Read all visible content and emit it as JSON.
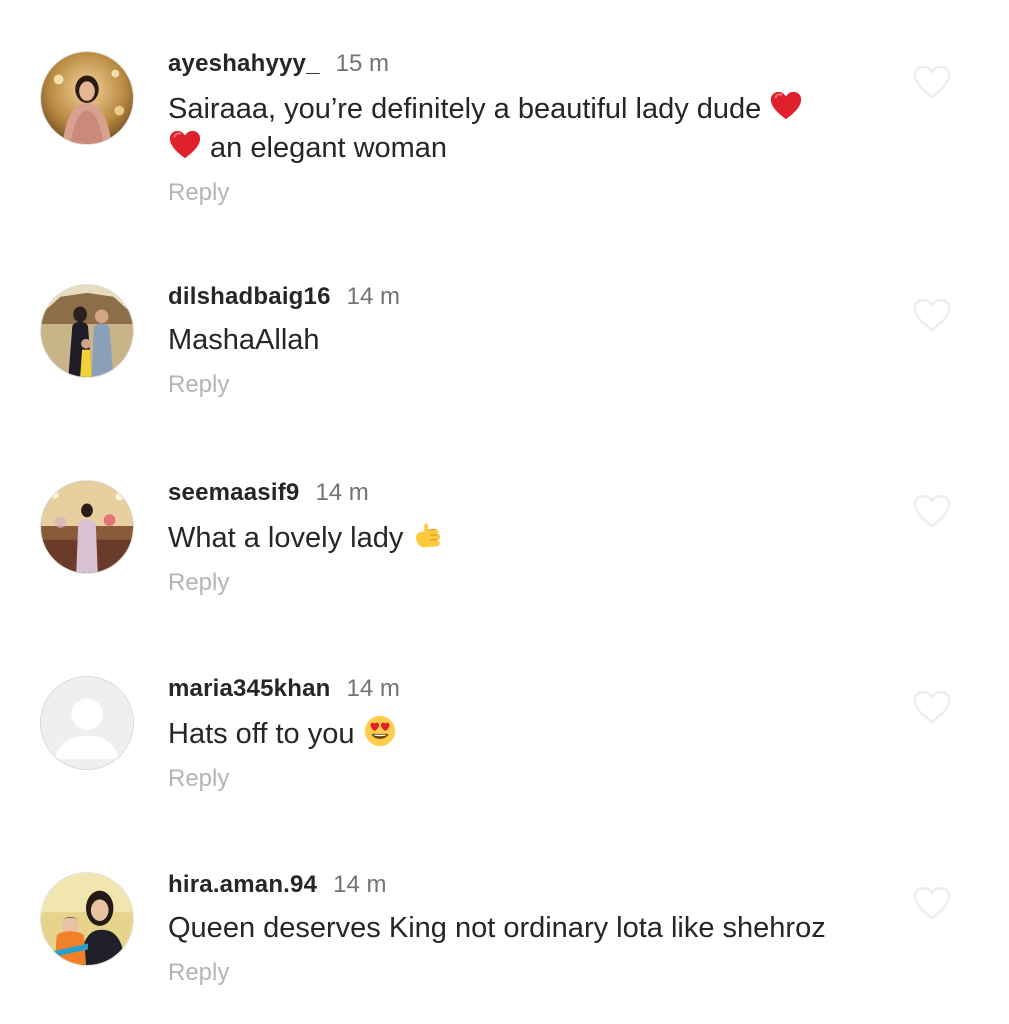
{
  "comments": [
    {
      "username": "ayeshahyyy_",
      "time": "15 m",
      "text_part1": "Sairaaa, you’re definitely a beautiful lady dude ",
      "text_part2": " an elegant woman",
      "emoji_1": "red-heart",
      "emoji_2": "red-heart",
      "reply_label": "Reply"
    },
    {
      "username": "dilshadbaig16",
      "time": "14 m",
      "text": "MashaAllah",
      "reply_label": "Reply"
    },
    {
      "username": "seemaasif9",
      "time": "14 m",
      "text": "What a lovely lady ",
      "emoji": "call-me-hand",
      "reply_label": "Reply"
    },
    {
      "username": "maria345khan",
      "time": "14 m",
      "text": "Hats off to you ",
      "emoji": "heart-eyes-face",
      "reply_label": "Reply"
    },
    {
      "username": "hira.aman.94",
      "time": "14 m",
      "text": "Queen deserves King not ordinary lota like shehroz",
      "reply_label": "Reply"
    }
  ],
  "colors": {
    "username": "#262626",
    "time": "#737373",
    "reply": "#b4b4b4",
    "like_outline": "#ececec"
  },
  "icons": {
    "like": "heart-outline-icon",
    "default_avatar": "default-avatar-icon"
  }
}
